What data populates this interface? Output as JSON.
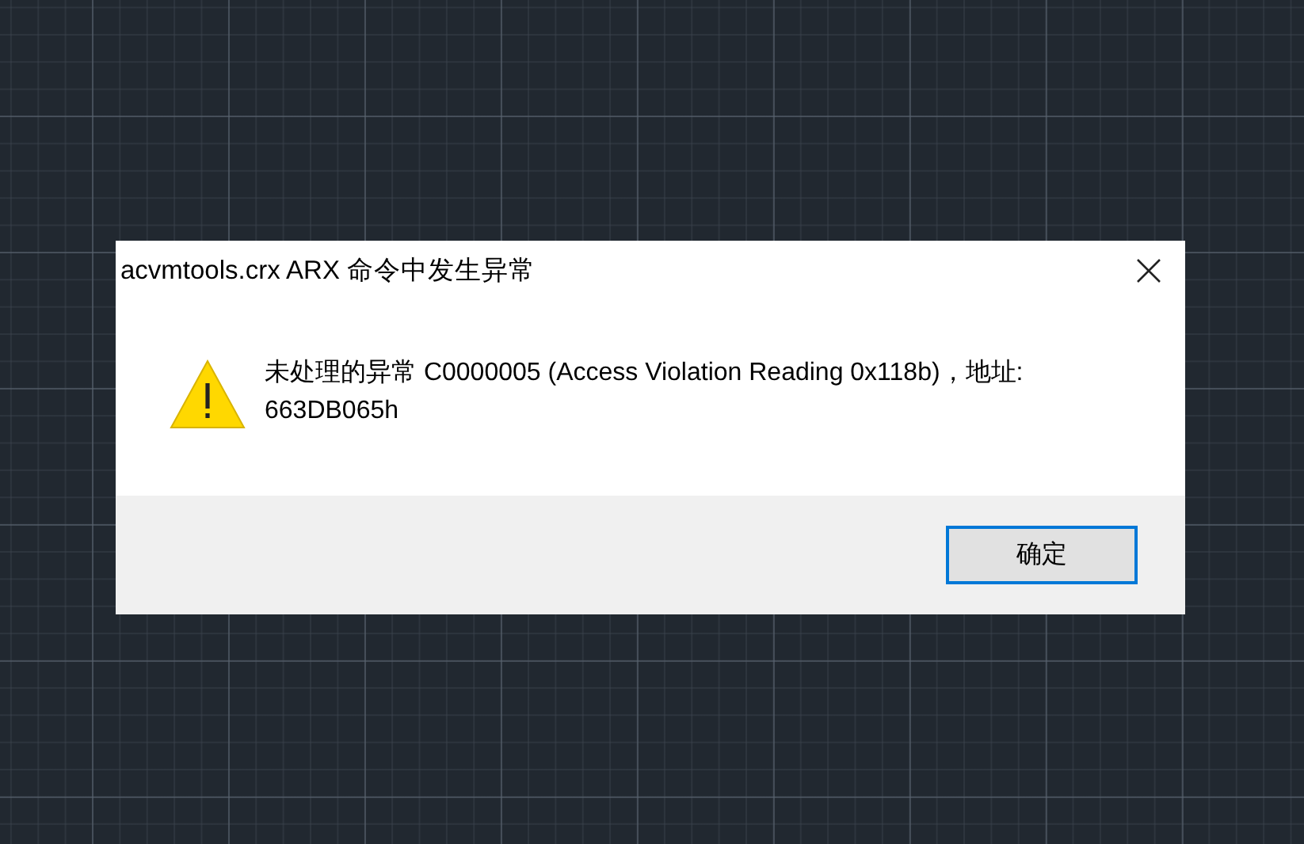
{
  "dialog": {
    "title": "acvmtools.crx ARX 命令中发生异常",
    "message": "未处理的异常 C0000005 (Access Violation Reading 0x118b)，地址:\n663DB065h",
    "buttons": [
      {
        "label": "确定",
        "focused": true
      }
    ]
  }
}
